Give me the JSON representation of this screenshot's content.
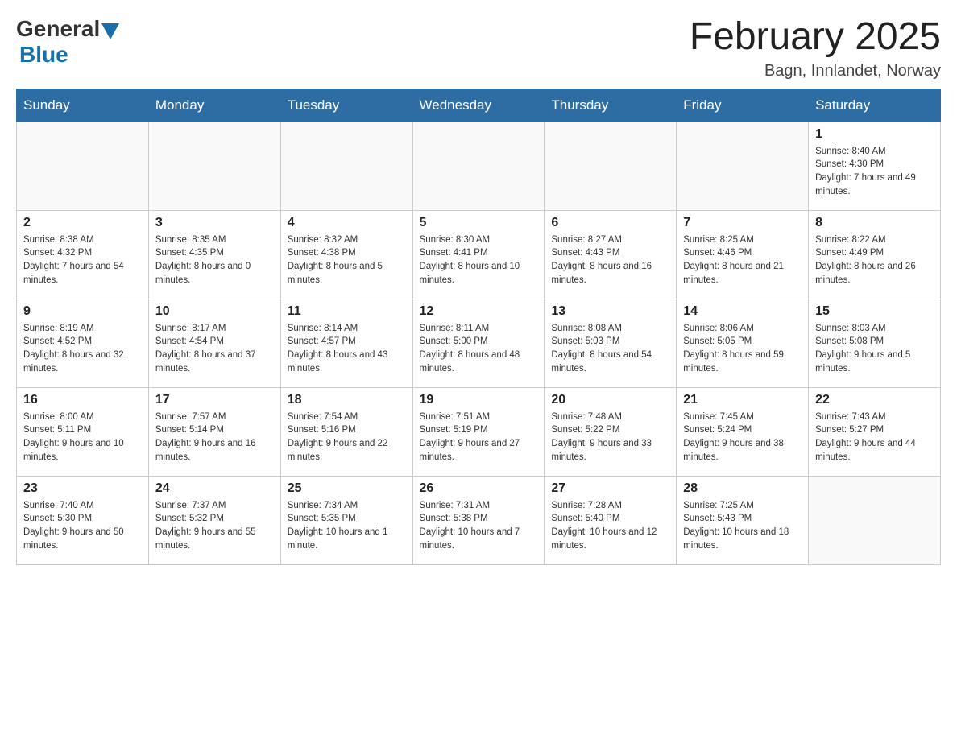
{
  "header": {
    "logo_general": "General",
    "logo_blue": "Blue",
    "month_title": "February 2025",
    "location": "Bagn, Innlandet, Norway"
  },
  "weekdays": [
    "Sunday",
    "Monday",
    "Tuesday",
    "Wednesday",
    "Thursday",
    "Friday",
    "Saturday"
  ],
  "weeks": [
    [
      {
        "day": "",
        "sunrise": "",
        "sunset": "",
        "daylight": ""
      },
      {
        "day": "",
        "sunrise": "",
        "sunset": "",
        "daylight": ""
      },
      {
        "day": "",
        "sunrise": "",
        "sunset": "",
        "daylight": ""
      },
      {
        "day": "",
        "sunrise": "",
        "sunset": "",
        "daylight": ""
      },
      {
        "day": "",
        "sunrise": "",
        "sunset": "",
        "daylight": ""
      },
      {
        "day": "",
        "sunrise": "",
        "sunset": "",
        "daylight": ""
      },
      {
        "day": "1",
        "sunrise": "Sunrise: 8:40 AM",
        "sunset": "Sunset: 4:30 PM",
        "daylight": "Daylight: 7 hours and 49 minutes."
      }
    ],
    [
      {
        "day": "2",
        "sunrise": "Sunrise: 8:38 AM",
        "sunset": "Sunset: 4:32 PM",
        "daylight": "Daylight: 7 hours and 54 minutes."
      },
      {
        "day": "3",
        "sunrise": "Sunrise: 8:35 AM",
        "sunset": "Sunset: 4:35 PM",
        "daylight": "Daylight: 8 hours and 0 minutes."
      },
      {
        "day": "4",
        "sunrise": "Sunrise: 8:32 AM",
        "sunset": "Sunset: 4:38 PM",
        "daylight": "Daylight: 8 hours and 5 minutes."
      },
      {
        "day": "5",
        "sunrise": "Sunrise: 8:30 AM",
        "sunset": "Sunset: 4:41 PM",
        "daylight": "Daylight: 8 hours and 10 minutes."
      },
      {
        "day": "6",
        "sunrise": "Sunrise: 8:27 AM",
        "sunset": "Sunset: 4:43 PM",
        "daylight": "Daylight: 8 hours and 16 minutes."
      },
      {
        "day": "7",
        "sunrise": "Sunrise: 8:25 AM",
        "sunset": "Sunset: 4:46 PM",
        "daylight": "Daylight: 8 hours and 21 minutes."
      },
      {
        "day": "8",
        "sunrise": "Sunrise: 8:22 AM",
        "sunset": "Sunset: 4:49 PM",
        "daylight": "Daylight: 8 hours and 26 minutes."
      }
    ],
    [
      {
        "day": "9",
        "sunrise": "Sunrise: 8:19 AM",
        "sunset": "Sunset: 4:52 PM",
        "daylight": "Daylight: 8 hours and 32 minutes."
      },
      {
        "day": "10",
        "sunrise": "Sunrise: 8:17 AM",
        "sunset": "Sunset: 4:54 PM",
        "daylight": "Daylight: 8 hours and 37 minutes."
      },
      {
        "day": "11",
        "sunrise": "Sunrise: 8:14 AM",
        "sunset": "Sunset: 4:57 PM",
        "daylight": "Daylight: 8 hours and 43 minutes."
      },
      {
        "day": "12",
        "sunrise": "Sunrise: 8:11 AM",
        "sunset": "Sunset: 5:00 PM",
        "daylight": "Daylight: 8 hours and 48 minutes."
      },
      {
        "day": "13",
        "sunrise": "Sunrise: 8:08 AM",
        "sunset": "Sunset: 5:03 PM",
        "daylight": "Daylight: 8 hours and 54 minutes."
      },
      {
        "day": "14",
        "sunrise": "Sunrise: 8:06 AM",
        "sunset": "Sunset: 5:05 PM",
        "daylight": "Daylight: 8 hours and 59 minutes."
      },
      {
        "day": "15",
        "sunrise": "Sunrise: 8:03 AM",
        "sunset": "Sunset: 5:08 PM",
        "daylight": "Daylight: 9 hours and 5 minutes."
      }
    ],
    [
      {
        "day": "16",
        "sunrise": "Sunrise: 8:00 AM",
        "sunset": "Sunset: 5:11 PM",
        "daylight": "Daylight: 9 hours and 10 minutes."
      },
      {
        "day": "17",
        "sunrise": "Sunrise: 7:57 AM",
        "sunset": "Sunset: 5:14 PM",
        "daylight": "Daylight: 9 hours and 16 minutes."
      },
      {
        "day": "18",
        "sunrise": "Sunrise: 7:54 AM",
        "sunset": "Sunset: 5:16 PM",
        "daylight": "Daylight: 9 hours and 22 minutes."
      },
      {
        "day": "19",
        "sunrise": "Sunrise: 7:51 AM",
        "sunset": "Sunset: 5:19 PM",
        "daylight": "Daylight: 9 hours and 27 minutes."
      },
      {
        "day": "20",
        "sunrise": "Sunrise: 7:48 AM",
        "sunset": "Sunset: 5:22 PM",
        "daylight": "Daylight: 9 hours and 33 minutes."
      },
      {
        "day": "21",
        "sunrise": "Sunrise: 7:45 AM",
        "sunset": "Sunset: 5:24 PM",
        "daylight": "Daylight: 9 hours and 38 minutes."
      },
      {
        "day": "22",
        "sunrise": "Sunrise: 7:43 AM",
        "sunset": "Sunset: 5:27 PM",
        "daylight": "Daylight: 9 hours and 44 minutes."
      }
    ],
    [
      {
        "day": "23",
        "sunrise": "Sunrise: 7:40 AM",
        "sunset": "Sunset: 5:30 PM",
        "daylight": "Daylight: 9 hours and 50 minutes."
      },
      {
        "day": "24",
        "sunrise": "Sunrise: 7:37 AM",
        "sunset": "Sunset: 5:32 PM",
        "daylight": "Daylight: 9 hours and 55 minutes."
      },
      {
        "day": "25",
        "sunrise": "Sunrise: 7:34 AM",
        "sunset": "Sunset: 5:35 PM",
        "daylight": "Daylight: 10 hours and 1 minute."
      },
      {
        "day": "26",
        "sunrise": "Sunrise: 7:31 AM",
        "sunset": "Sunset: 5:38 PM",
        "daylight": "Daylight: 10 hours and 7 minutes."
      },
      {
        "day": "27",
        "sunrise": "Sunrise: 7:28 AM",
        "sunset": "Sunset: 5:40 PM",
        "daylight": "Daylight: 10 hours and 12 minutes."
      },
      {
        "day": "28",
        "sunrise": "Sunrise: 7:25 AM",
        "sunset": "Sunset: 5:43 PM",
        "daylight": "Daylight: 10 hours and 18 minutes."
      },
      {
        "day": "",
        "sunrise": "",
        "sunset": "",
        "daylight": ""
      }
    ]
  ]
}
